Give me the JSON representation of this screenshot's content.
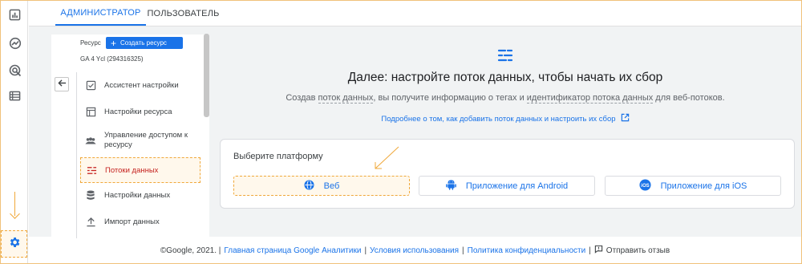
{
  "tabs": [
    {
      "label": "АДМИНИСТРАТОР",
      "active": true
    },
    {
      "label": "ПОЛЬЗОВАТЕЛЬ",
      "active": false
    }
  ],
  "rail": {
    "icons": [
      "bar-chart-icon",
      "explore-icon",
      "ads-target-icon",
      "list-icon"
    ],
    "settings_icon": "gear-icon"
  },
  "property": {
    "label": "Ресурс",
    "create_button": "Создать ресурс",
    "name": "GA 4 Ycl (294316325)"
  },
  "menu": {
    "items": [
      {
        "label": "Ассистент настройки",
        "icon": "checklist-icon"
      },
      {
        "label": "Настройки ресурса",
        "icon": "layout-icon"
      },
      {
        "label": "Управление доступом к ресурсу",
        "icon": "people-icon"
      },
      {
        "label": "Потоки данных",
        "icon": "streams-icon",
        "active": true
      },
      {
        "label": "Настройки данных",
        "icon": "database-icon"
      },
      {
        "label": "Импорт данных",
        "icon": "upload-icon"
      }
    ]
  },
  "main": {
    "title": "Далее: настройте поток данных, чтобы начать их сбор",
    "desc_part1": "Создав ",
    "desc_link1": "поток данных",
    "desc_part2": ", вы получите информацию о тегах и ",
    "desc_link2": "идентификатор потока данных",
    "desc_part3": " для веб-потоков.",
    "learn_more": "Подробнее о том, как добавить поток данных и настроить их сбор"
  },
  "platform": {
    "title": "Выберите платформу",
    "buttons": [
      {
        "label": "Веб",
        "icon": "globe-icon"
      },
      {
        "label": "Приложение для Android",
        "icon": "android-icon"
      },
      {
        "label": "Приложение для iOS",
        "icon": "ios-icon"
      }
    ]
  },
  "footer": {
    "copyright": "©Google, 2021. |",
    "link1": "Главная страница Google Аналитики",
    "sep1": "|",
    "link2": "Условия использования",
    "sep2": "|",
    "link3": "Политика конфиденциальности",
    "sep3": "|",
    "feedback": "Отправить отзыв"
  },
  "colors": {
    "accent": "#1a73e8",
    "active_menu": "#c5221f",
    "annotation": "#f0a83a"
  }
}
